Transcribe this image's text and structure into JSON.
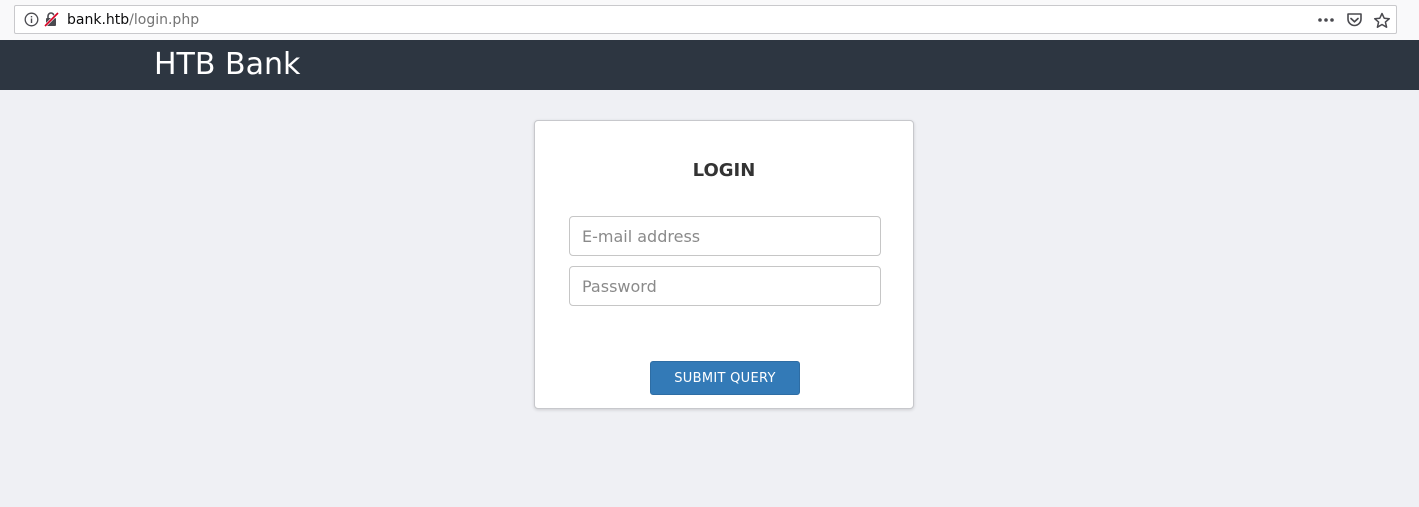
{
  "browser": {
    "url_host": "bank.htb",
    "url_path": "/login.php",
    "icons": {
      "info": "info-icon",
      "insecure": "insecure-connection-icon",
      "more": "more-actions-icon",
      "pocket": "pocket-icon",
      "bookmark": "star-icon"
    }
  },
  "header": {
    "brand": "HTB Bank",
    "background": "#2d3641"
  },
  "login": {
    "title": "LOGIN",
    "email_placeholder": "E-mail address",
    "email_value": "",
    "password_placeholder": "Password",
    "password_value": "",
    "submit_label": "Submit Query",
    "button_color": "#337ab7"
  }
}
